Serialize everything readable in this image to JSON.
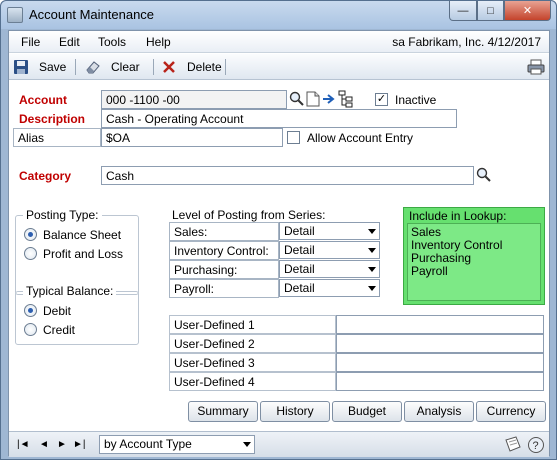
{
  "window": {
    "title": "Account Maintenance",
    "minimize_glyph": "—",
    "maximize_glyph": "□",
    "close_glyph": "✕"
  },
  "menu": {
    "items": [
      "File",
      "Edit",
      "Tools",
      "Help"
    ],
    "status": "sa  Fabrikam, Inc.  4/12/2017"
  },
  "toolbar": {
    "save_label": "Save",
    "clear_label": "Clear",
    "delete_label": "Delete",
    "icons": [
      "save-icon",
      "eraser-icon",
      "delete-x-icon",
      "printer-icon"
    ]
  },
  "account": {
    "label": "Account",
    "value": "000 -1100 -00",
    "inactive_label": "Inactive",
    "inactive_checked": true,
    "lookup_icons": [
      "magnifier-icon",
      "note-icon",
      "arrow-right-icon",
      "hierarchy-icon"
    ]
  },
  "description": {
    "label": "Description",
    "value": "Cash - Operating Account"
  },
  "alias": {
    "label": "Alias",
    "value": "$OA",
    "allow_entry_label": "Allow Account Entry",
    "allow_entry_checked": false
  },
  "category": {
    "label": "Category",
    "value": "Cash"
  },
  "posting_type": {
    "title": "Posting Type:",
    "options": [
      {
        "label": "Balance Sheet",
        "selected": true
      },
      {
        "label": "Profit and Loss",
        "selected": false
      }
    ]
  },
  "typical_balance": {
    "title": "Typical Balance:",
    "options": [
      {
        "label": "Debit",
        "selected": true
      },
      {
        "label": "Credit",
        "selected": false
      }
    ]
  },
  "level_of_posting": {
    "title": "Level of Posting from Series:",
    "rows": [
      {
        "label": "Sales:",
        "value": "Detail"
      },
      {
        "label": "Inventory Control:",
        "value": "Detail"
      },
      {
        "label": "Purchasing:",
        "value": "Detail"
      },
      {
        "label": "Payroll:",
        "value": "Detail"
      }
    ]
  },
  "include_in_lookup": {
    "title": "Include in Lookup:",
    "items": [
      "Sales",
      "Inventory Control",
      "Purchasing",
      "Payroll"
    ],
    "color": "#66e06f"
  },
  "user_defined": [
    {
      "label": "User-Defined 1",
      "value": ""
    },
    {
      "label": "User-Defined 2",
      "value": ""
    },
    {
      "label": "User-Defined 3",
      "value": ""
    },
    {
      "label": "User-Defined 4",
      "value": ""
    }
  ],
  "buttons": {
    "summary": "Summary",
    "history": "History",
    "budget": "Budget",
    "analysis": "Analysis",
    "currency": "Currency"
  },
  "statusbar": {
    "sort_value": "by Account Type",
    "nav_first": "|◄",
    "nav_prev": "◄",
    "nav_next": "►",
    "nav_last": "►|"
  },
  "accent_color_required": "#c00000"
}
